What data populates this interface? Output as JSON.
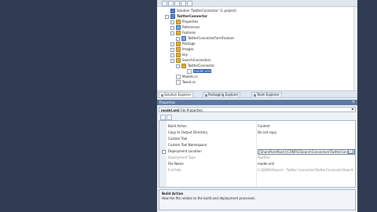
{
  "solution_explorer": {
    "tree": [
      {
        "label": "Solution 'TwitterConnector' (1 project)",
        "level": 0,
        "icon": "solution-icon",
        "expander": false,
        "bold": false,
        "selected": false
      },
      {
        "label": "TwitterConnector",
        "level": 0,
        "icon": "project-icon",
        "expander": true,
        "bold": true,
        "selected": false
      },
      {
        "label": "Properties",
        "level": 1,
        "icon": "folder-icon",
        "expander": true,
        "bold": false,
        "selected": false
      },
      {
        "label": "References",
        "level": 1,
        "icon": "references-icon",
        "expander": true,
        "bold": false,
        "selected": false
      },
      {
        "label": "Features",
        "level": 1,
        "icon": "folder-icon",
        "expander": true,
        "bold": false,
        "selected": false
      },
      {
        "label": "TwitterConnectorFarmFeature",
        "level": 2,
        "icon": "feature-icon",
        "expander": true,
        "bold": false,
        "selected": false
      },
      {
        "label": "Package",
        "level": 1,
        "icon": "folder-icon",
        "expander": true,
        "bold": false,
        "selected": false
      },
      {
        "label": "Images",
        "level": 1,
        "icon": "folder-icon",
        "expander": true,
        "bold": false,
        "selected": false
      },
      {
        "label": "key",
        "level": 1,
        "icon": "folder-icon",
        "expander": true,
        "bold": false,
        "selected": false
      },
      {
        "label": "SearchConnectors",
        "level": 1,
        "icon": "folder-icon",
        "expander": true,
        "bold": false,
        "selected": false
      },
      {
        "label": "TwitterConnector",
        "level": 2,
        "icon": "folder-icon",
        "expander": true,
        "bold": false,
        "selected": false
      },
      {
        "label": "model.xml",
        "level": 3,
        "icon": "file-icon",
        "expander": false,
        "bold": false,
        "selected": true
      },
      {
        "label": "Models.cs",
        "level": 1,
        "icon": "file-icon",
        "expander": false,
        "bold": false,
        "selected": false
      },
      {
        "label": "Tweet.cs",
        "level": 1,
        "icon": "file-icon",
        "expander": false,
        "bold": false,
        "selected": false
      }
    ]
  },
  "tabs": [
    {
      "label": "Solution Explorer",
      "active": true
    },
    {
      "label": "Packaging Explorer",
      "active": false
    },
    {
      "label": "Team Explorer",
      "active": false
    }
  ],
  "properties": {
    "title": "Properties",
    "object_name": "model.xml",
    "object_type": "File Properties",
    "rows": [
      {
        "key": "Build Action",
        "value": "Content",
        "muted": false,
        "boxed": false,
        "expander": false
      },
      {
        "key": "Copy to Output Directory",
        "value": "Do not copy",
        "muted": false,
        "boxed": false,
        "expander": false
      },
      {
        "key": "Custom Tool",
        "value": "",
        "muted": false,
        "boxed": false,
        "expander": false
      },
      {
        "key": "Custom Tool Namespace",
        "value": "",
        "muted": false,
        "boxed": false,
        "expander": false
      },
      {
        "key": "Deployment Location",
        "value": "{SharePointRoot}\\CONFIG\\SearchConnectors\\TwitterConnector\\",
        "muted": false,
        "boxed": true,
        "expander": true
      },
      {
        "key": "Deployment Type",
        "value": "RootFile",
        "muted": true,
        "boxed": false,
        "expander": false
      },
      {
        "key": "File Name",
        "value": "model.xml",
        "muted": false,
        "boxed": false,
        "expander": false
      },
      {
        "key": "Full Path",
        "value": "C:\\DEMO\\Search - Twitter Connector\\TwitterConnector\\SearchConn",
        "muted": true,
        "boxed": false,
        "expander": false
      }
    ],
    "description_title": "Build Action",
    "description_text": "How the file relates to the build and deployment processes."
  }
}
